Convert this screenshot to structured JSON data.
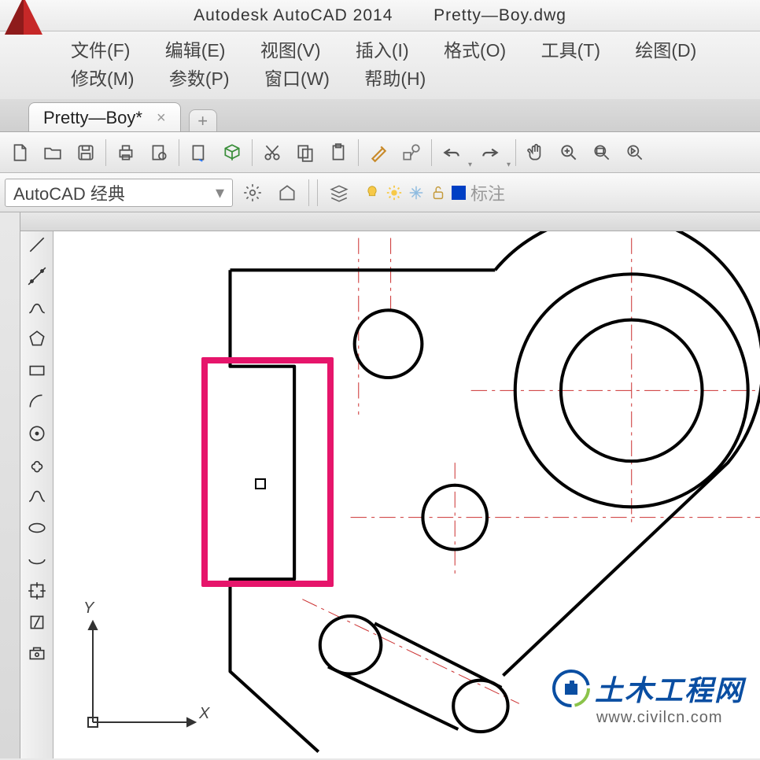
{
  "titlebar": {
    "app": "Autodesk AutoCAD 2014",
    "file": "Pretty—Boy.dwg"
  },
  "menus": {
    "row1": [
      "文件(F)",
      "编辑(E)",
      "视图(V)",
      "插入(I)",
      "格式(O)",
      "工具(T)",
      "绘图(D)"
    ],
    "row2": [
      "修改(M)",
      "参数(P)",
      "窗口(W)",
      "帮助(H)"
    ]
  },
  "tabs": {
    "active": "Pretty—Boy*"
  },
  "workspace": {
    "selected": "AutoCAD 经典"
  },
  "layer": {
    "current": "标注"
  },
  "ucs": {
    "x": "X",
    "y": "Y"
  },
  "watermark": {
    "title": "土木工程网",
    "url": "www.civilcn.com"
  },
  "left_tool_names": [
    "line",
    "construction-line",
    "polyline",
    "polygon",
    "rectangle",
    "arc",
    "circle",
    "revision-cloud",
    "spline",
    "ellipse",
    "ellipse-arc",
    "insert-block",
    "make-block",
    "point"
  ]
}
